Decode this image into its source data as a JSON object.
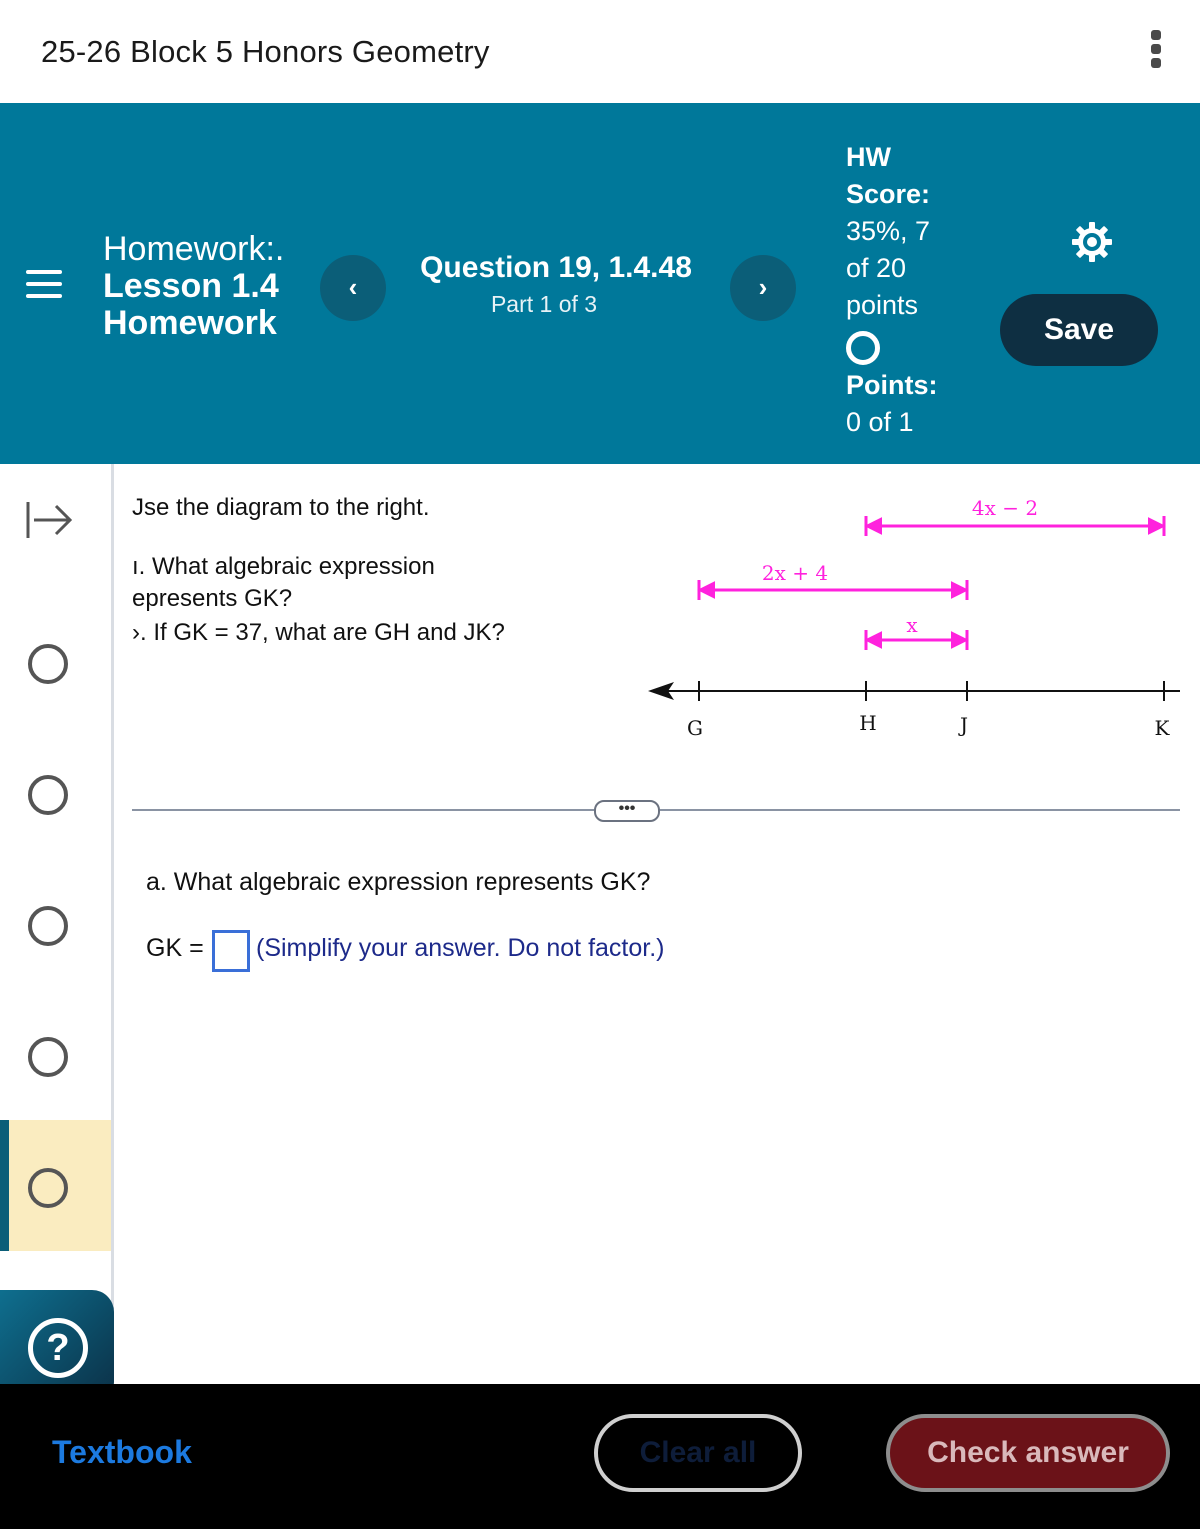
{
  "course": {
    "title": "25-26 Block 5 Honors Geometry"
  },
  "header": {
    "homework_line1": "Homework:.",
    "homework_line2": "Lesson 1.4",
    "homework_line3": "Homework",
    "question": "Question 19, 1.4.48",
    "part": "Part 1 of 3",
    "prev_glyph": "‹",
    "next_glyph": "›",
    "score_label_1": "HW",
    "score_label_2": "Score:",
    "score_value_1": "35%, 7",
    "score_value_2": "of 20",
    "score_value_3": "points",
    "points_label": "Points:",
    "points_value": "0 of 1",
    "save_label": "Save"
  },
  "sidebar": {
    "question_dots": 5,
    "active_index": 4
  },
  "question": {
    "intro": "Jse the diagram to the right.",
    "part_a_line1": "ı. What algebraic expression",
    "part_a_line2": "epresents GK?",
    "part_b": "›. If GK = 37, what are GH and JK?",
    "sub_question": "a. What algebraic expression represents GK?",
    "answer_label": "GK =",
    "answer_value": "",
    "hint": "(Simplify your answer. Do not factor.)"
  },
  "diagram": {
    "points": [
      "G",
      "H",
      "J",
      "K"
    ],
    "segments": [
      {
        "label": "4x − 2",
        "from": "H",
        "to": "K"
      },
      {
        "label": "2x + 4",
        "from": "G",
        "to": "J"
      },
      {
        "label": "x",
        "from": "H",
        "to": "J"
      }
    ],
    "accent_color": "#ff22dd"
  },
  "footer": {
    "textbook": "Textbook",
    "clear_all": "Clear all",
    "check_answer": "Check answer"
  },
  "colors": {
    "header_bg": "#00789a",
    "save_bg": "#0e2f42",
    "active_row": "#faecc0",
    "link": "#1c7ae0",
    "hint": "#1d2a8a"
  }
}
